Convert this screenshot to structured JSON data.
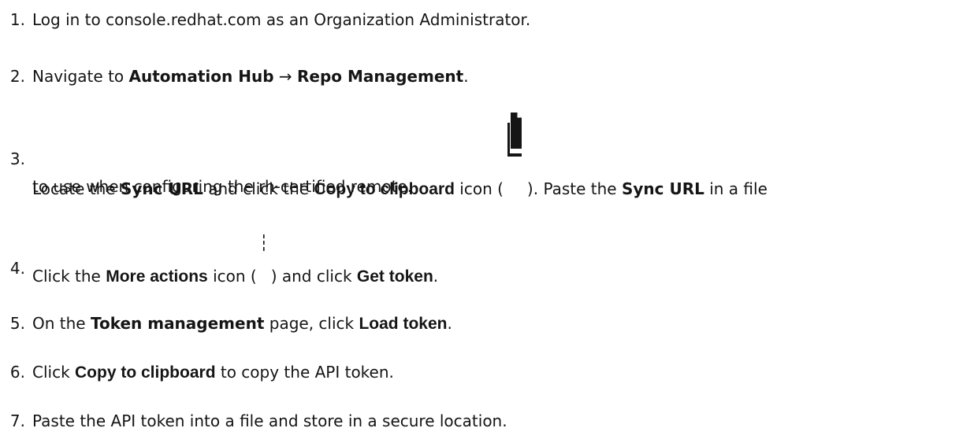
{
  "steps": [
    {
      "num": "1.",
      "text": "Log in to console.redhat.com as an Organization Administrator."
    },
    {
      "num": "2.",
      "t1": "Navigate to ",
      "g1": "Automation Hub",
      "arrow": " → ",
      "g2": "Repo Management",
      "t2": "."
    },
    {
      "num": "3.",
      "t1": "Locate the ",
      "g1": "Sync URL",
      "t2": " and click the ",
      "b1": "Copy to clipboard",
      "t3": " icon (",
      "icon": "copy-to-clipboard-icon",
      "t4": "). Paste the ",
      "g2": "Sync URL",
      "t5": " in a file",
      "line2": "to use when configuring the rh-certified remote."
    },
    {
      "num": "4.",
      "t1": "Click the ",
      "b1": "More actions",
      "t2": " icon (",
      "icon": "more-actions-kebab-icon",
      "t3": ") and click ",
      "b2": "Get token",
      "t4": "."
    },
    {
      "num": "5.",
      "t1": "On the ",
      "g1": "Token management",
      "t2": " page, click ",
      "b1": "Load token",
      "t3": "."
    },
    {
      "num": "6.",
      "t1": "Click ",
      "b1": "Copy to clipboard",
      "t2": " to copy the API token."
    },
    {
      "num": "7.",
      "text": "Paste the API token into a file and store in a secure location."
    }
  ]
}
